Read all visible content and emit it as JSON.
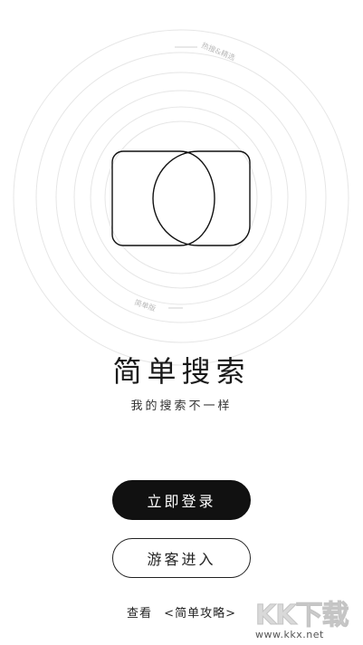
{
  "background_rings": {
    "outer_tag": "热搜&精选",
    "inner_tag": "简单版"
  },
  "app": {
    "title": "简单搜索",
    "subtitle": "我的搜索不一样"
  },
  "actions": {
    "login_label": "立即登录",
    "guest_label": "游客进入"
  },
  "footer": {
    "prefix": "查看",
    "link_label": "<简单攻略>"
  },
  "watermark": {
    "logo_text": "KK下载",
    "url": "www.kkx.net"
  },
  "colors": {
    "primary": "#111111",
    "background": "#ffffff",
    "ring": "#e6e6e6"
  }
}
